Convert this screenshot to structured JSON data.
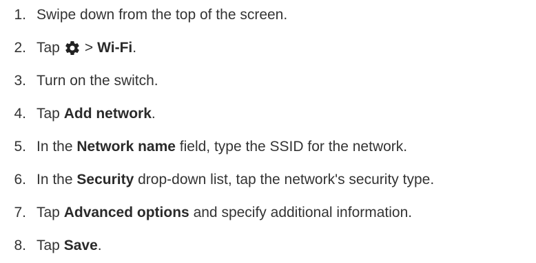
{
  "steps": [
    {
      "num": "1.",
      "parts": [
        "Swipe down from the top of the screen."
      ]
    },
    {
      "num": "2.",
      "pre": "Tap",
      "icon": "gear-icon",
      "sep": ">",
      "bold": "Wi-Fi",
      "post": "."
    },
    {
      "num": "3.",
      "parts": [
        "Turn on the switch."
      ]
    },
    {
      "num": "4.",
      "pre": "Tap",
      "bold": "Add network",
      "post": "."
    },
    {
      "num": "5.",
      "pre": "In the",
      "bold": "Network name",
      "post": "field, type the SSID for the network."
    },
    {
      "num": "6.",
      "pre": "In the",
      "bold": "Security",
      "post": "drop-down list, tap the network's security type."
    },
    {
      "num": "7.",
      "pre": "Tap",
      "bold": "Advanced options",
      "post": "and specify additional information."
    },
    {
      "num": "8.",
      "pre": "Tap",
      "bold": "Save",
      "post": "."
    }
  ],
  "colors": {
    "text": "#333333",
    "icon": "#222222"
  }
}
